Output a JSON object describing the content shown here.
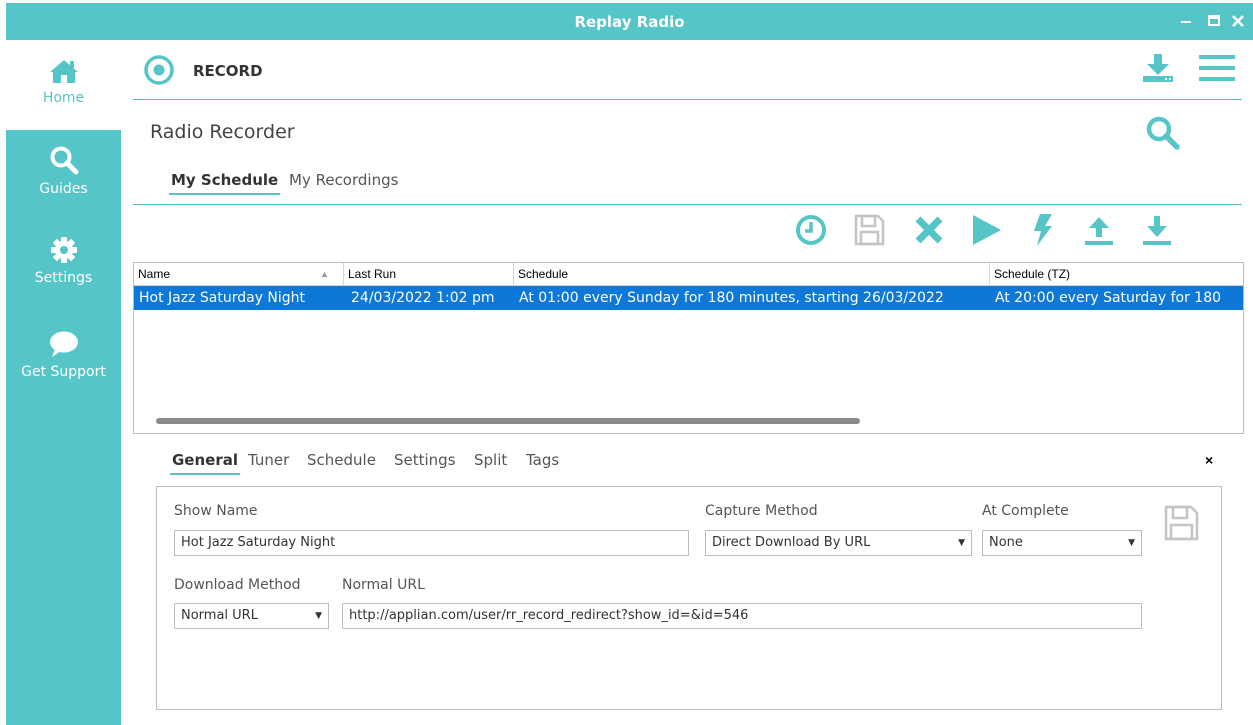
{
  "window": {
    "title": "Replay Radio"
  },
  "sidebar": {
    "items": [
      {
        "id": "home",
        "label": "Home",
        "icon": "home-icon",
        "active": true
      },
      {
        "id": "guides",
        "label": "Guides",
        "icon": "search-icon"
      },
      {
        "id": "settings",
        "label": "Settings",
        "icon": "gear-icon"
      },
      {
        "id": "support",
        "label": "Get Support",
        "icon": "chat-bubble-icon"
      }
    ]
  },
  "header": {
    "section": "RECORD",
    "icons": [
      "record-icon",
      "download-icon",
      "menu-icon"
    ]
  },
  "page": {
    "title": "Radio Recorder",
    "tabs": [
      {
        "label": "My Schedule",
        "active": true
      },
      {
        "label": "My Recordings",
        "active": false
      }
    ]
  },
  "toolbar": {
    "icons": [
      "clock-icon",
      "save-icon",
      "delete-icon",
      "play-icon",
      "lightning-icon",
      "upload-icon",
      "download-icon"
    ]
  },
  "grid": {
    "columns": [
      "Name",
      "Last Run",
      "Schedule",
      "Schedule (TZ)"
    ],
    "sort_indicator": "▲",
    "rows": [
      {
        "name": "Hot Jazz Saturday Night",
        "last_run": "24/03/2022 1:02 pm",
        "schedule": "At 01:00 every Sunday for 180 minutes, starting 26/03/2022",
        "schedule_tz": "At 20:00 every Saturday for 180",
        "selected": true
      }
    ]
  },
  "detail": {
    "tabs": [
      {
        "label": "General",
        "active": true
      },
      {
        "label": "Tuner"
      },
      {
        "label": "Schedule"
      },
      {
        "label": "Settings"
      },
      {
        "label": "Split"
      },
      {
        "label": "Tags"
      }
    ],
    "close": "×",
    "fields": {
      "show_name": {
        "label": "Show Name",
        "value": "Hot Jazz Saturday Night"
      },
      "capture_method": {
        "label": "Capture Method",
        "value": "Direct Download By URL"
      },
      "at_complete": {
        "label": "At Complete",
        "value": "None"
      },
      "download_method": {
        "label": "Download Method",
        "value": "Normal URL"
      },
      "normal_url": {
        "label": "Normal URL",
        "value": "http://applian.com/user/rr_record_redirect?show_id=&id=546"
      }
    }
  },
  "colors": {
    "accent": "#56c5c8",
    "selection": "#0d78d8",
    "text": "#333333"
  }
}
